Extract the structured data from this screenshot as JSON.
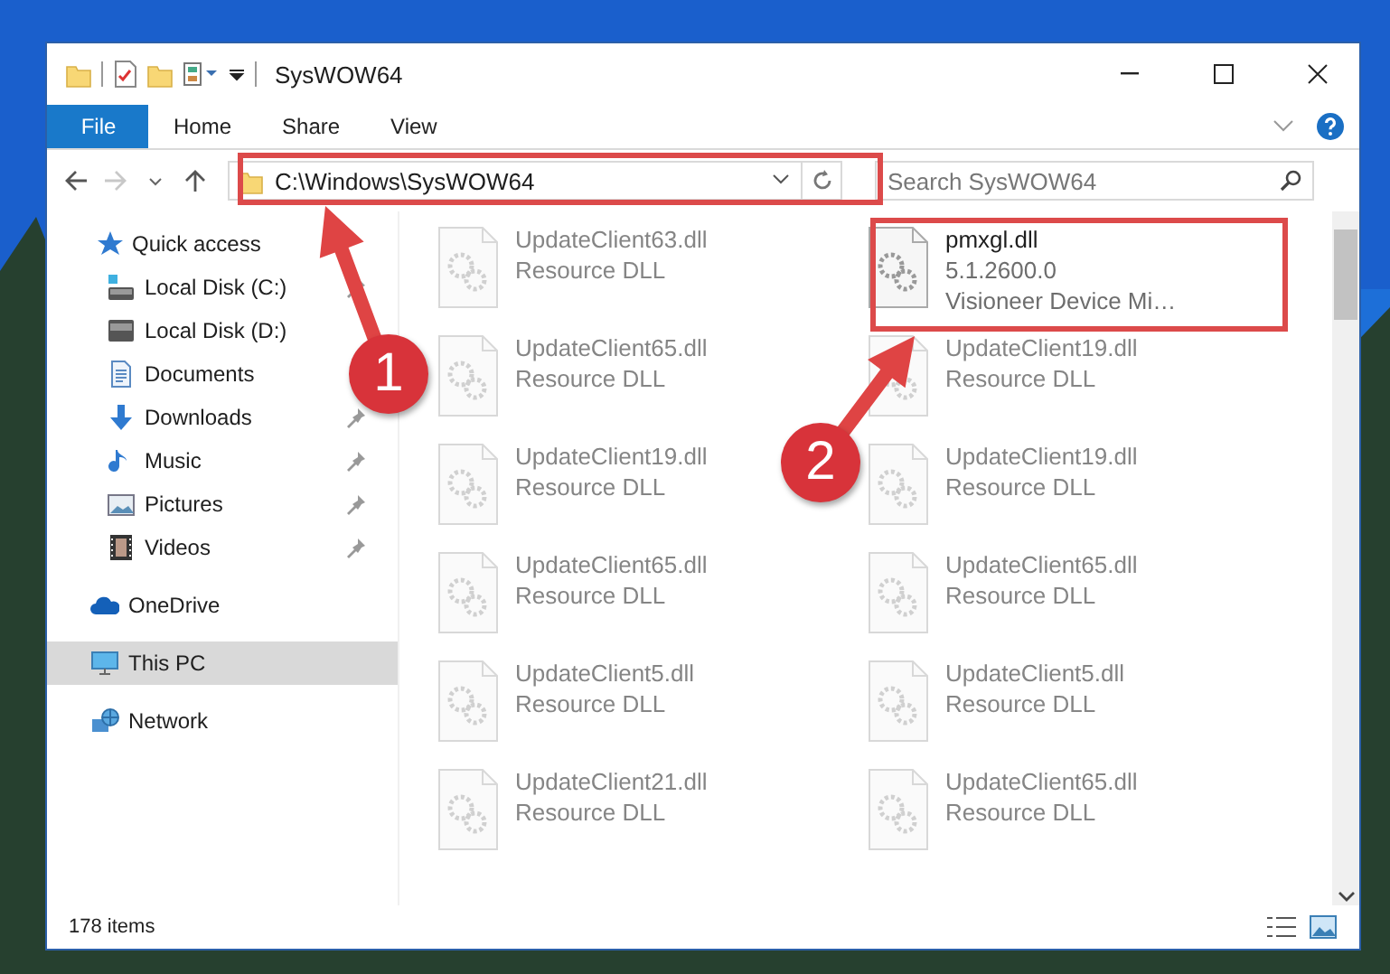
{
  "window": {
    "title": "SysWOW64",
    "ribbon_tabs": [
      {
        "label": "File",
        "selected": true
      },
      {
        "label": "Home",
        "selected": false
      },
      {
        "label": "Share",
        "selected": false
      },
      {
        "label": "View",
        "selected": false
      }
    ],
    "address": "C:\\Windows\\SysWOW64",
    "search": {
      "placeholder": "Search SysWOW64"
    },
    "nav": [
      {
        "label": "Quick access",
        "selected": false,
        "children": [
          {
            "label": "Local Disk (C:)",
            "pinned": true
          },
          {
            "label": "Local Disk (D:)",
            "pinned": false
          },
          {
            "label": "Documents",
            "pinned": false
          },
          {
            "label": "Downloads",
            "pinned": true
          },
          {
            "label": "Music",
            "pinned": true
          },
          {
            "label": "Pictures",
            "pinned": true
          },
          {
            "label": "Videos",
            "pinned": true
          }
        ]
      },
      {
        "label": "OneDrive",
        "selected": false
      },
      {
        "label": "This PC",
        "selected": true
      },
      {
        "label": "Network",
        "selected": false
      }
    ],
    "files": [
      {
        "name": "UpdateClient63.dll",
        "lines": [
          "Resource DLL"
        ],
        "dimmed": true
      },
      {
        "name": "pmxgl.dll",
        "lines": [
          "5.1.2600.0",
          "Visioneer Device Mi…"
        ],
        "dimmed": false
      },
      {
        "name": "UpdateClient65.dll",
        "lines": [
          "Resource DLL"
        ],
        "dimmed": true
      },
      {
        "name": "UpdateClient19.dll",
        "lines": [
          "Resource DLL"
        ],
        "dimmed": true
      },
      {
        "name": "UpdateClient19.dll",
        "lines": [
          "Resource DLL"
        ],
        "dimmed": true
      },
      {
        "name": "UpdateClient19.dll",
        "lines": [
          "Resource DLL"
        ],
        "dimmed": true
      },
      {
        "name": "UpdateClient65.dll",
        "lines": [
          "Resource DLL"
        ],
        "dimmed": true
      },
      {
        "name": "UpdateClient65.dll",
        "lines": [
          "Resource DLL"
        ],
        "dimmed": true
      },
      {
        "name": "UpdateClient5.dll",
        "lines": [
          "Resource DLL"
        ],
        "dimmed": true
      },
      {
        "name": "UpdateClient5.dll",
        "lines": [
          "Resource DLL"
        ],
        "dimmed": true
      },
      {
        "name": "UpdateClient21.dll",
        "lines": [
          "Resource DLL"
        ],
        "dimmed": true
      },
      {
        "name": "UpdateClient65.dll",
        "lines": [
          "Resource DLL"
        ],
        "dimmed": true
      }
    ],
    "status_bar": "178 items"
  },
  "annotations": [
    {
      "number": "1"
    },
    {
      "number": "2"
    }
  ]
}
